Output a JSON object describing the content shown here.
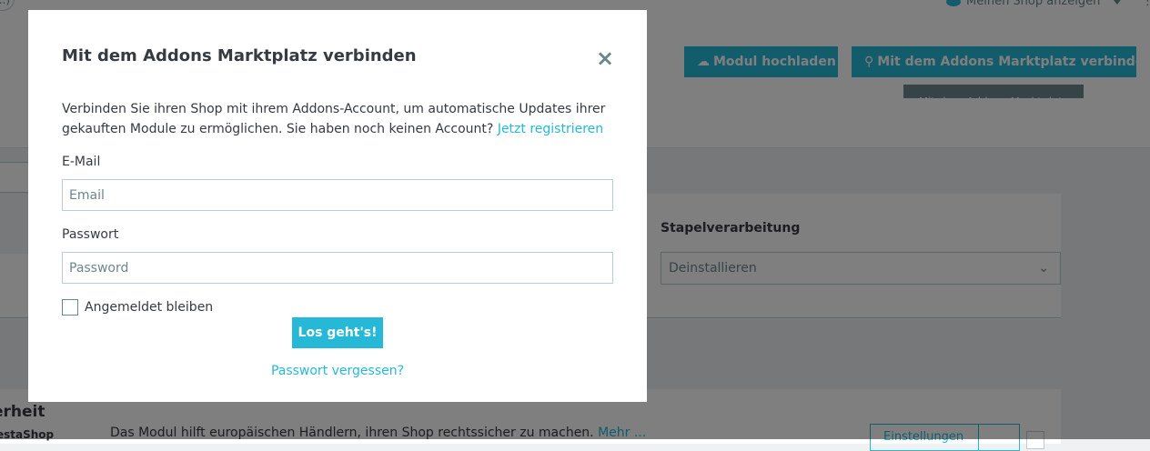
{
  "topbar": {
    "left_pill": "...)",
    "shop_link": "Meinen Shop anzeigen",
    "notifications_icon": "bell-icon"
  },
  "header": {
    "upload_button": "Modul hochladen",
    "connect_button": "Mit dem Addons Marktplatz verbinden",
    "tooltip": "Mit dem Addons Marktplatz verbinden"
  },
  "batch": {
    "label": "Stapelverarbeitung",
    "selected": "Deinstallieren"
  },
  "module": {
    "title": "erheit",
    "author": "estaShop",
    "description": "Das Modul hilft europäischen Händlern, ihren Shop rechtssicher zu machen.",
    "more_link": "Mehr ...",
    "settings_button": "Einstellungen"
  },
  "modal": {
    "title": "Mit dem Addons Marktplatz verbinden",
    "close_icon": "close-icon",
    "intro": "Verbinden Sie ihren Shop mit ihrem Addons-Account, um automatische Updates ihrer gekauften Module zu ermöglichen. Sie haben noch keinen Account?",
    "register_link": "Jetzt registrieren",
    "email_label": "E-Mail",
    "email_placeholder": "Email",
    "password_label": "Passwort",
    "password_placeholder": "Password",
    "remember_label": "Angemeldet bleiben",
    "submit_button": "Los geht's!",
    "forgot_link": "Passwort vergessen?"
  },
  "colors": {
    "accent": "#25b9d7",
    "text": "#363a41",
    "muted": "#6c868e",
    "border": "#bbcdd2"
  }
}
